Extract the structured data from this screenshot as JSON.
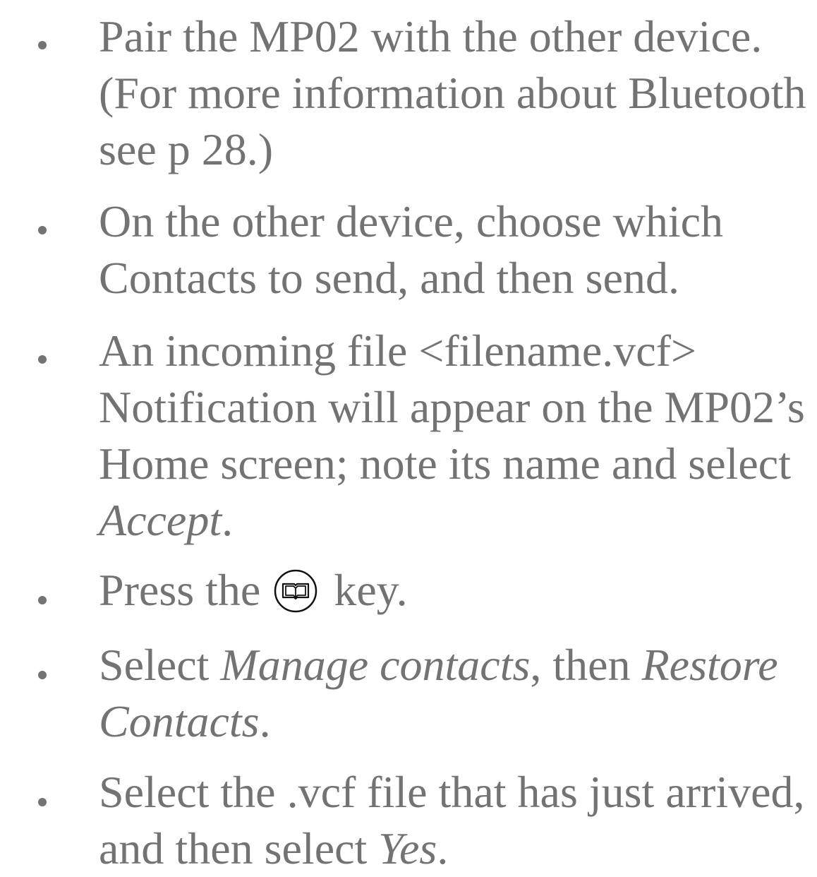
{
  "steps": [
    {
      "text": "Pair the MP02 with the other device. (For more information about Bluetooth see p 28.)"
    },
    {
      "text": "On the other device, choose which Contacts to send, and then send."
    },
    {
      "text_before": "An incoming file <filename.vcf> Notification will appear on the MP02’s Home screen; note its name and select ",
      "emphasis": "Accept",
      "text_after": "."
    },
    {
      "text_before": "Press the",
      "icon": "book-key-icon",
      "text_after": "key."
    },
    {
      "text_before": "Select ",
      "emphasis_1": "Manage contacts",
      "text_middle": ", then ",
      "emphasis_2": "Restore Contacts",
      "text_after": "."
    },
    {
      "text_before": "Select the .vcf file that has just arrived, and then select ",
      "emphasis": "Yes",
      "text_after": "."
    }
  ]
}
